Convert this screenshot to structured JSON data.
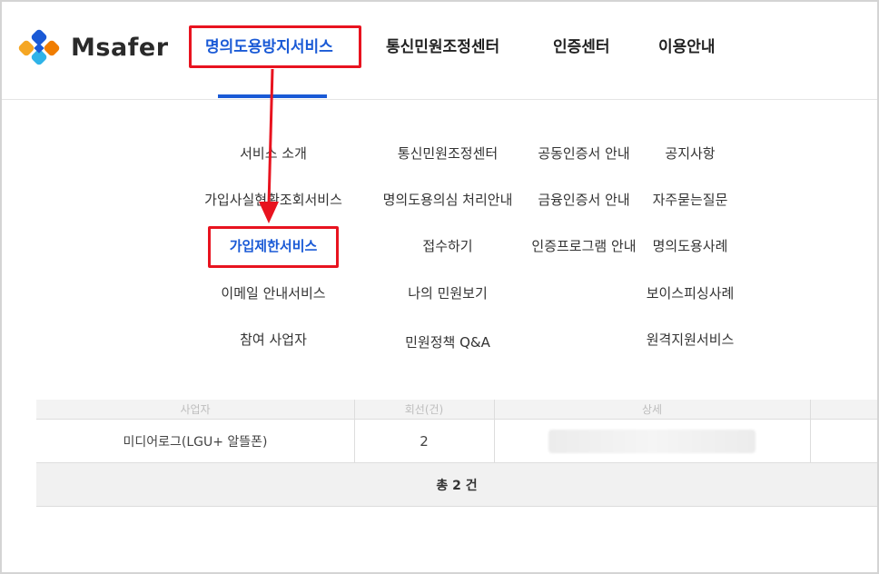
{
  "logo": {
    "text": "Msafer",
    "colors": [
      "#f5a623",
      "#1a5ad6",
      "#2fb3e8",
      "#f07d00"
    ]
  },
  "nav": {
    "items": [
      {
        "label": "명의도용방지서비스",
        "active": true
      },
      {
        "label": "통신민원조정센터"
      },
      {
        "label": "인증센터"
      },
      {
        "label": "이용안내"
      }
    ],
    "accent": "#1a5ad6"
  },
  "menu": {
    "col1": [
      "서비스 소개",
      "가입사실현황조회서비스",
      "가입제한서비스",
      "이메일 안내서비스",
      "참여 사업자"
    ],
    "col2": [
      "통신민원조정센터",
      "명의도용의심 처리안내",
      "접수하기",
      "나의 민원보기",
      "민원정책 Q&A"
    ],
    "col3": [
      "공동인증서 안내",
      "금융인증서 안내",
      "인증프로그램 안내"
    ],
    "col4": [
      "공지사항",
      "자주묻는질문",
      "명의도용사례",
      "보이스피싱사례",
      "원격지원서비스"
    ]
  },
  "table": {
    "header_ghost": [
      "사업자",
      "회선(건)",
      "상세"
    ],
    "rows": [
      {
        "carrier": "미디어로그(LGU+ 알뜰폰)",
        "count": "2"
      }
    ],
    "total": "총 2 건"
  },
  "highlight_color": "#e8131f"
}
